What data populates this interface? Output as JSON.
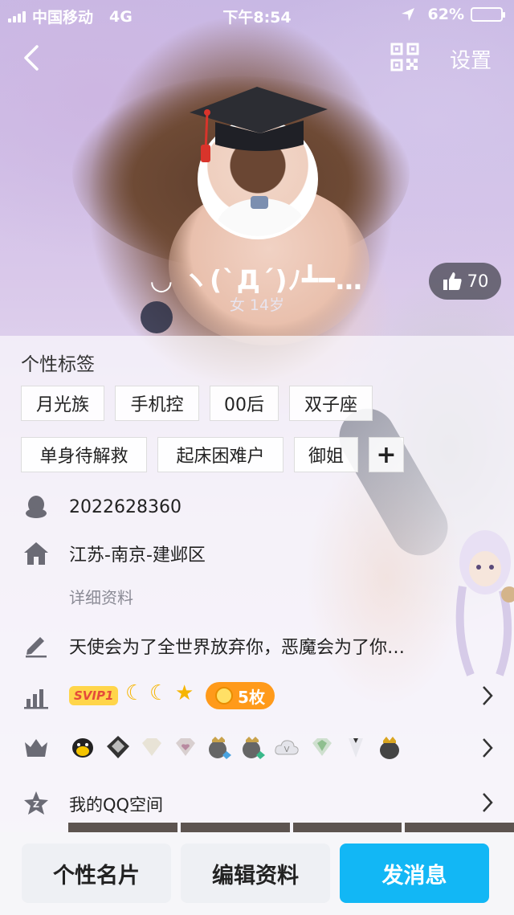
{
  "status_bar": {
    "carrier": "中国移动",
    "network": "4G",
    "time": "下午8:54",
    "battery_percent": "62%",
    "battery_level": 0.62
  },
  "nav": {
    "back_icon": "chevron-left-icon",
    "qr_icon": "qr-code-icon",
    "settings_label": "设置"
  },
  "profile": {
    "nickname": "◡ ヽ(`Д´)ﾉ┻━…",
    "gender_age": "女  14岁",
    "likes": "70"
  },
  "tags": {
    "title": "个性标签",
    "items": [
      "月光族",
      "手机控",
      "00后",
      "双子座",
      "单身待解救",
      "起床困难户",
      "御姐"
    ],
    "add_label": "+"
  },
  "info": {
    "qq_number": "2022628360",
    "location": "江苏-南京-建邺区",
    "details_link": "详细资料",
    "signature": "天使会为了全世界放弃你，恶魔会为了你…",
    "svip_label": "SVIP1",
    "medal_count": "5枚",
    "qzone_label": "我的QQ空间"
  },
  "actions": {
    "card": "个性名片",
    "edit": "编辑资料",
    "message": "发消息"
  },
  "colors": {
    "primary": "#12b7f5",
    "medal": "#ff9a1a",
    "svip": "#ffd54a",
    "battery": "#f6c300"
  }
}
